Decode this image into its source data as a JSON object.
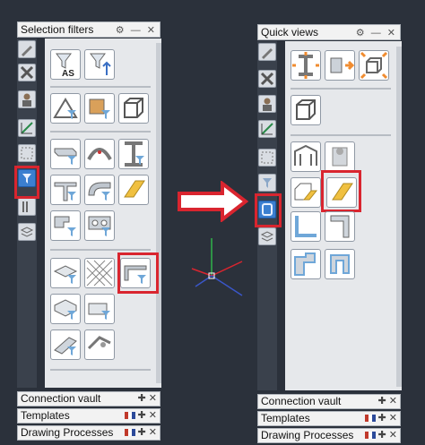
{
  "left_panel": {
    "title": "Selection filters",
    "bottom_rows": [
      {
        "label": "Connection vault",
        "has_flag": false
      },
      {
        "label": "Templates",
        "has_flag": true
      },
      {
        "label": "Drawing Processes",
        "has_flag": true
      }
    ],
    "tiles": [
      {
        "name": "filter-as-tile",
        "label": "AS"
      }
    ]
  },
  "right_panel": {
    "title": "Quick views",
    "bottom_rows": [
      {
        "label": "Connection vault",
        "has_flag": false
      },
      {
        "label": "Templates",
        "has_flag": true
      },
      {
        "label": "Drawing Processes",
        "has_flag": true
      }
    ]
  },
  "title_controls": "⚙ — ✕",
  "bottom_controls": "✚ ✕",
  "colors": {
    "highlight": "#d9252f",
    "active_icon": "#3b7fd0",
    "background": "#2b313b"
  }
}
